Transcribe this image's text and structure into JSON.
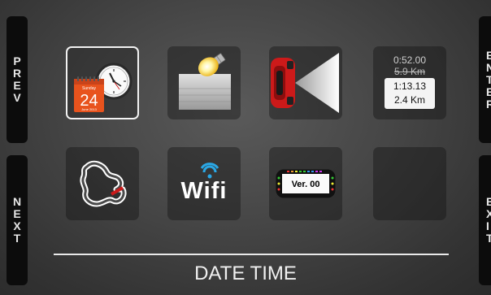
{
  "nav": {
    "prev_label": [
      "P",
      "R",
      "E",
      "V"
    ],
    "next_label": [
      "N",
      "E",
      "X",
      "T"
    ],
    "enter_label": [
      "E",
      "N",
      "T",
      "E",
      "R"
    ],
    "exit_label": [
      "E",
      "X",
      "I",
      "T"
    ]
  },
  "tiles": [
    {
      "name": "date-time-tile",
      "icon": "calendar-clock-icon",
      "calendar_day_name": "Sunday",
      "calendar_day": "24",
      "calendar_month_year": "June 2013",
      "selected": true
    },
    {
      "name": "backlight-tile",
      "icon": "bulb-icon"
    },
    {
      "name": "beacon-tile",
      "icon": "car-beacon-icon"
    },
    {
      "name": "lap-tile",
      "icon": "lap-time-icon",
      "time_old": "0:52.00",
      "dist_old": "5.9 Km",
      "time_new": "1:13.13",
      "dist_new": "2.4 Km"
    },
    {
      "name": "track-tile",
      "icon": "track-icon"
    },
    {
      "name": "wifi-tile",
      "icon": "wifi-icon",
      "label": "Wifi"
    },
    {
      "name": "version-tile",
      "icon": "dash-display-icon",
      "label": "Ver. 00"
    },
    {
      "name": "empty-tile",
      "icon": ""
    }
  ],
  "footer": {
    "label": "DATE TIME"
  },
  "colors": {
    "calendar_orange": "#e8531d",
    "beacon_red": "#cc1a1a",
    "wifi_blue": "#2aa8e6"
  }
}
